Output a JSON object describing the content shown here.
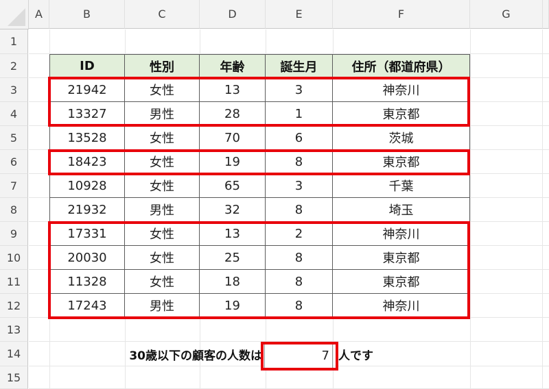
{
  "spreadsheet": {
    "column_headers": [
      "A",
      "B",
      "C",
      "D",
      "E",
      "F",
      "G"
    ],
    "row_headers": [
      "1",
      "2",
      "3",
      "4",
      "5",
      "6",
      "7",
      "8",
      "9",
      "10",
      "11",
      "12",
      "13",
      "14",
      "15"
    ],
    "table": {
      "headers": [
        "ID",
        "性別",
        "年齢",
        "誕生月",
        "住所（都道府県）"
      ],
      "rows": [
        [
          "21942",
          "女性",
          "13",
          "3",
          "神奈川"
        ],
        [
          "13327",
          "男性",
          "28",
          "1",
          "東京都"
        ],
        [
          "13528",
          "女性",
          "70",
          "6",
          "茨城"
        ],
        [
          "18423",
          "女性",
          "19",
          "8",
          "東京都"
        ],
        [
          "10928",
          "女性",
          "65",
          "3",
          "千葉"
        ],
        [
          "21932",
          "男性",
          "32",
          "8",
          "埼玉"
        ],
        [
          "17331",
          "女性",
          "13",
          "2",
          "神奈川"
        ],
        [
          "20030",
          "女性",
          "25",
          "8",
          "東京都"
        ],
        [
          "11328",
          "女性",
          "18",
          "8",
          "東京都"
        ],
        [
          "17243",
          "男性",
          "19",
          "8",
          "神奈川"
        ]
      ]
    },
    "summary": {
      "label": "30歳以下の顧客の人数は",
      "value": "7",
      "suffix": "人です"
    },
    "highlight_color": "#e8000b",
    "header_fill_color": "#e2efda",
    "highlighted_rows": [
      [
        3,
        4
      ],
      [
        6,
        6
      ],
      [
        9,
        12
      ]
    ]
  }
}
